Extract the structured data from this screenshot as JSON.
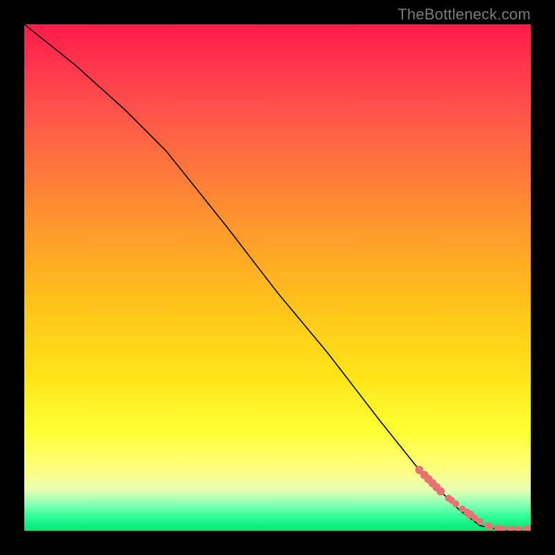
{
  "attribution": "TheBottleneck.com",
  "colors": {
    "top": "#ff1a4a",
    "middle": "#ffe61a",
    "bottom": "#00e673",
    "curve": "#000000",
    "points": "#e57373",
    "frame": "#000000"
  },
  "chart_data": {
    "type": "line",
    "title": "",
    "xlabel": "",
    "ylabel": "",
    "xlim": [
      0,
      100
    ],
    "ylim": [
      0,
      100
    ],
    "series": [
      {
        "name": "bottleneck-curve",
        "x": [
          0,
          10,
          20,
          28,
          40,
          50,
          60,
          70,
          78,
          82,
          86,
          90,
          95,
          100
        ],
        "y": [
          100,
          92,
          83,
          75,
          60,
          47,
          35,
          22,
          12,
          8,
          4,
          1,
          0,
          0
        ]
      }
    ],
    "scatter": {
      "name": "sample-points",
      "x": [
        78.0,
        79.0,
        79.8,
        80.6,
        81.4,
        82.2,
        83.8,
        84.4,
        85.2,
        86.5,
        87.4,
        88.0,
        89.0,
        90.0,
        91.5,
        92.0,
        93.5,
        94.5,
        96.0,
        97.5,
        99.0,
        100.0
      ],
      "y": [
        12.0,
        11.0,
        10.2,
        9.4,
        8.6,
        7.8,
        6.4,
        6.0,
        5.3,
        4.3,
        3.7,
        3.2,
        2.5,
        1.8,
        1.0,
        0.8,
        0.5,
        0.4,
        0.3,
        0.3,
        0.3,
        0.3
      ],
      "r": [
        6,
        6,
        6,
        6,
        6,
        6,
        5,
        5,
        5,
        5,
        5,
        6,
        5,
        5,
        5,
        5,
        5,
        5,
        5,
        5,
        5,
        6
      ]
    }
  }
}
